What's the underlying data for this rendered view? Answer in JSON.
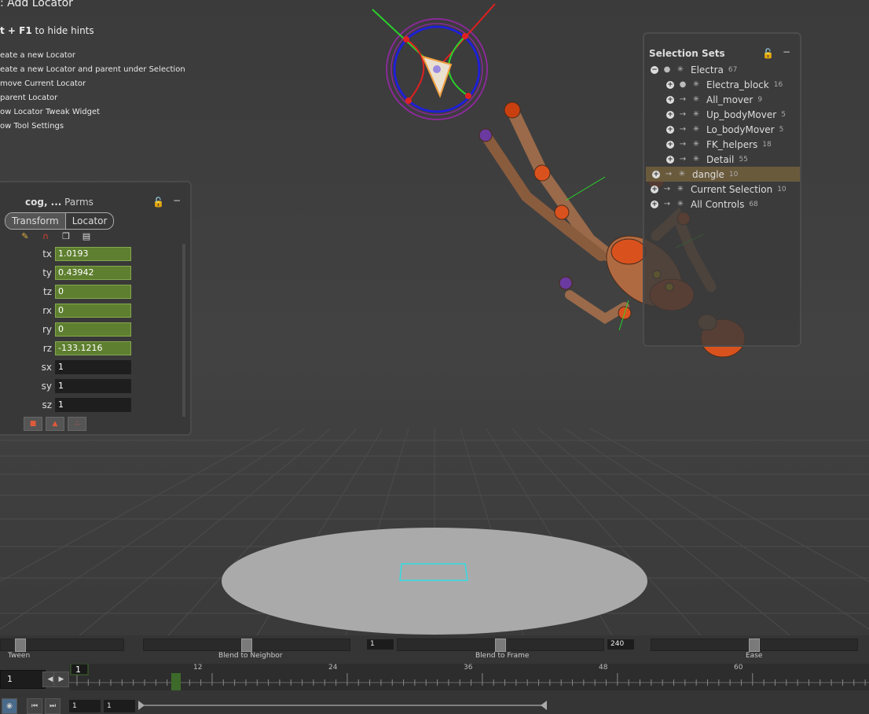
{
  "hints": {
    "title": ": Add Locator",
    "toggle_key": "t + F1",
    "toggle_text": " to hide hints",
    "items": [
      "eate a new Locator",
      "eate a new Locator and parent under Selection",
      "move Current Locator",
      "parent Locator",
      "ow Locator Tweak Widget",
      "ow Tool Settings"
    ]
  },
  "parms": {
    "title_bold": "cog, ...",
    "title_rest": " Parms",
    "tabs": [
      "Transform",
      "Locator"
    ],
    "fields": [
      {
        "label": "tx",
        "value": "1.0193",
        "keyed": true
      },
      {
        "label": "ty",
        "value": "0.43942",
        "keyed": true
      },
      {
        "label": "tz",
        "value": "0",
        "keyed": true
      },
      {
        "label": "rx",
        "value": "0",
        "keyed": true
      },
      {
        "label": "ry",
        "value": "0",
        "keyed": true
      },
      {
        "label": "rz",
        "value": "-133.1216",
        "keyed": true
      },
      {
        "label": "sx",
        "value": "1",
        "keyed": false
      },
      {
        "label": "sy",
        "value": "1",
        "keyed": false
      },
      {
        "label": "sz",
        "value": "1",
        "keyed": false
      }
    ],
    "colors": {
      "keyed": "#5e7f2f"
    }
  },
  "selection_sets": {
    "title": "Selection Sets",
    "sets": [
      {
        "name": "Electra",
        "count": "67",
        "level": 0,
        "expanded": true,
        "highlight": false
      },
      {
        "name": "Electra_block",
        "count": "16",
        "level": 1,
        "expanded": false,
        "highlight": false
      },
      {
        "name": "All_mover",
        "count": "9",
        "level": 1,
        "expanded": false,
        "highlight": false
      },
      {
        "name": "Up_bodyMover",
        "count": "5",
        "level": 1,
        "expanded": false,
        "highlight": false
      },
      {
        "name": "Lo_bodyMover",
        "count": "5",
        "level": 1,
        "expanded": false,
        "highlight": false
      },
      {
        "name": "FK_helpers",
        "count": "18",
        "level": 1,
        "expanded": false,
        "highlight": false
      },
      {
        "name": "Detail",
        "count": "55",
        "level": 1,
        "expanded": false,
        "highlight": false
      },
      {
        "name": "dangle",
        "count": "10",
        "level": 0,
        "expanded": false,
        "highlight": true
      },
      {
        "name": "Current Selection",
        "count": "10",
        "level": 0,
        "expanded": false,
        "highlight": false
      },
      {
        "name": "All Controls",
        "count": "68",
        "level": 0,
        "expanded": false,
        "highlight": false
      }
    ]
  },
  "timeline": {
    "sliders": [
      {
        "label": "Tween"
      },
      {
        "label": "Blend to Neighbor"
      },
      {
        "label": "Blend to Frame"
      },
      {
        "label": "Ease"
      }
    ],
    "blend_start": "1",
    "blend_end": "240",
    "current_frame": "1",
    "playhead_frame": "1",
    "tick_labels": [
      "12",
      "24",
      "36",
      "48",
      "60"
    ],
    "range_start": "1",
    "range_end": "1"
  }
}
